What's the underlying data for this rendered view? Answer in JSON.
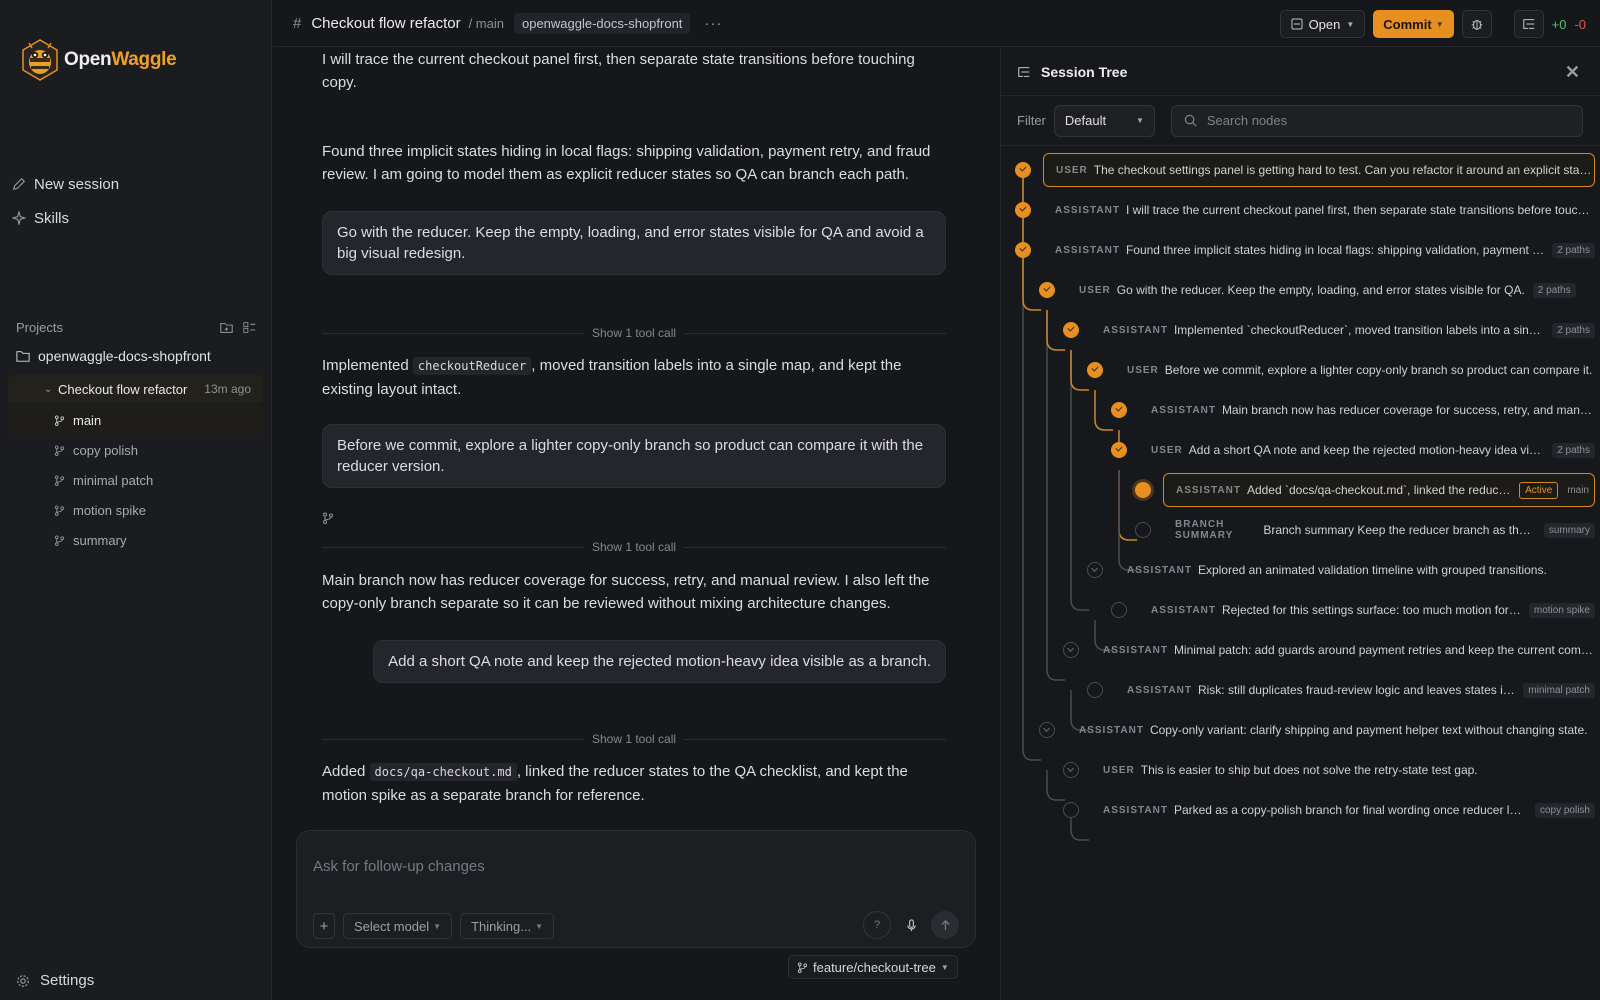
{
  "app": {
    "name_part1": "Open",
    "name_part2": "Waggle"
  },
  "sidebar": {
    "new_session": "New session",
    "skills": "Skills",
    "projects_label": "Projects",
    "project_name": "openwaggle-docs-shopfront",
    "session": {
      "title": "Checkout flow refactor",
      "time": "13m ago"
    },
    "branches": [
      "main",
      "copy polish",
      "minimal patch",
      "motion spike",
      "summary"
    ],
    "settings": "Settings"
  },
  "header": {
    "title": "Checkout flow refactor",
    "branch_crumb": "/ main",
    "repo": "openwaggle-docs-shopfront",
    "more": "···",
    "open_label": "Open",
    "commit_label": "Commit",
    "diff_plus": "+0",
    "diff_minus": "-0"
  },
  "chat": {
    "m1": "I will trace the current checkout panel first, then separate state transitions before touching copy.",
    "m2": "Found three implicit states hiding in local flags: shipping validation, payment retry, and fraud review. I am going to model them as explicit reducer states so QA can branch each path.",
    "u1": "Go with the reducer. Keep the empty, loading, and error states visible for QA and avoid a big visual redesign.",
    "tool_call": "Show 1 tool call",
    "m3_pre": "Implemented",
    "m3_code": "checkoutReducer",
    "m3_post": ", moved transition labels into a single map, and kept the existing layout intact.",
    "u2": "Before we commit, explore a lighter copy-only branch so product can compare it with the reducer version.",
    "m4": "Main branch now has reducer coverage for success, retry, and manual review. I also left the copy-only branch separate so it can be reviewed without mixing architecture changes.",
    "u3": "Add a short QA note and keep the rejected motion-heavy idea visible as a branch.",
    "m5_pre": "Added",
    "m5_code": "docs/qa-checkout.md",
    "m5_post": ", linked the reducer states to the QA checklist, and kept the motion spike as a separate branch for reference."
  },
  "composer": {
    "placeholder": "Ask for follow-up changes",
    "plus": "+",
    "model": "Select model",
    "thinking": "Thinking...",
    "help": "?",
    "branch": "feature/checkout-tree"
  },
  "tree_panel": {
    "title": "Session Tree",
    "filter_label": "Filter",
    "filter_value": "Default",
    "search_placeholder": "Search nodes",
    "nodes": [
      {
        "role": "USER",
        "text": "The checkout settings panel is getting hard to test. Can you refactor it around an explicit state model?",
        "tag": ""
      },
      {
        "role": "ASSISTANT",
        "text": "I will trace the current checkout panel first, then separate state transitions before touching copy.",
        "tag": ""
      },
      {
        "role": "ASSISTANT",
        "text": "Found three implicit states hiding in local flags: shipping validation, payment retry, and fraud review.",
        "tag": "2 paths"
      },
      {
        "role": "USER",
        "text": "Go with the reducer. Keep the empty, loading, and error states visible for QA.",
        "tag": "2 paths"
      },
      {
        "role": "ASSISTANT",
        "text": "Implemented `checkoutReducer`, moved transition labels into a single map.",
        "tag": "2 paths"
      },
      {
        "role": "USER",
        "text": "Before we commit, explore a lighter copy-only branch so product can compare it.",
        "tag": ""
      },
      {
        "role": "ASSISTANT",
        "text": "Main branch now has reducer coverage for success, retry, and manual review.",
        "tag": ""
      },
      {
        "role": "USER",
        "text": "Add a short QA note and keep the rejected motion-heavy idea visible as a branch.",
        "tag": "2 paths"
      },
      {
        "role": "ASSISTANT",
        "text": "Added `docs/qa-checkout.md`, linked the reducer states to the QA checklist.",
        "tag": "Active",
        "tag2": "main"
      },
      {
        "role": "BRANCH SUMMARY",
        "text": "Branch summary Keep the reducer branch as the mainline candidate.",
        "tag": "summary"
      },
      {
        "role": "ASSISTANT",
        "text": "Explored an animated validation timeline with grouped transitions.",
        "tag": ""
      },
      {
        "role": "ASSISTANT",
        "text": "Rejected for this settings surface: too much motion for a form.",
        "tag": "motion spike"
      },
      {
        "role": "ASSISTANT",
        "text": "Minimal patch: add guards around payment retries and keep the current component.",
        "tag": ""
      },
      {
        "role": "ASSISTANT",
        "text": "Risk: still duplicates fraud-review logic and leaves states implicit.",
        "tag": "minimal patch"
      },
      {
        "role": "ASSISTANT",
        "text": "Copy-only variant: clarify shipping and payment helper text without changing state.",
        "tag": ""
      },
      {
        "role": "USER",
        "text": "This is easier to ship but does not solve the retry-state test gap.",
        "tag": ""
      },
      {
        "role": "ASSISTANT",
        "text": "Parked as a copy-polish branch for final wording once reducer lands.",
        "tag": "copy polish"
      }
    ]
  },
  "colors": {
    "accent": "#e7901f",
    "bg": "#16171a",
    "panel": "#1b1c20"
  }
}
